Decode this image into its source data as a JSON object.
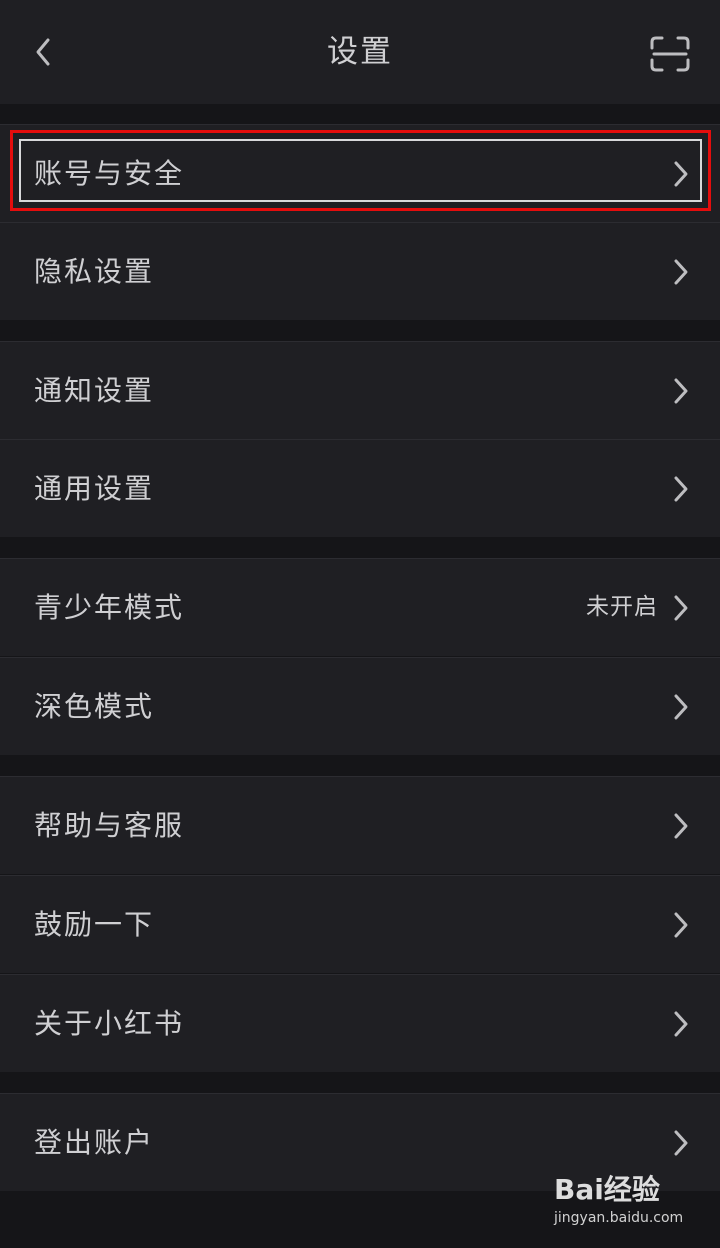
{
  "header": {
    "title": "设置"
  },
  "settings": [
    {
      "label": "账号与安全",
      "value": ""
    },
    {
      "label": "隐私设置",
      "value": ""
    },
    {
      "label": "通知设置",
      "value": ""
    },
    {
      "label": "通用设置",
      "value": ""
    },
    {
      "label": "青少年模式",
      "value": "未开启"
    },
    {
      "label": "深色模式",
      "value": ""
    },
    {
      "label": "帮助与客服",
      "value": ""
    },
    {
      "label": "鼓励一下",
      "value": ""
    },
    {
      "label": "关于小红书",
      "value": ""
    },
    {
      "label": "登出账户",
      "value": ""
    }
  ],
  "watermark": {
    "brand": "Bai经验",
    "url": "jingyan.baidu.com"
  },
  "colors": {
    "background": "#151518",
    "row": "#1f1f23",
    "text": "#cfcfd2",
    "highlight": "#e50d0d"
  }
}
